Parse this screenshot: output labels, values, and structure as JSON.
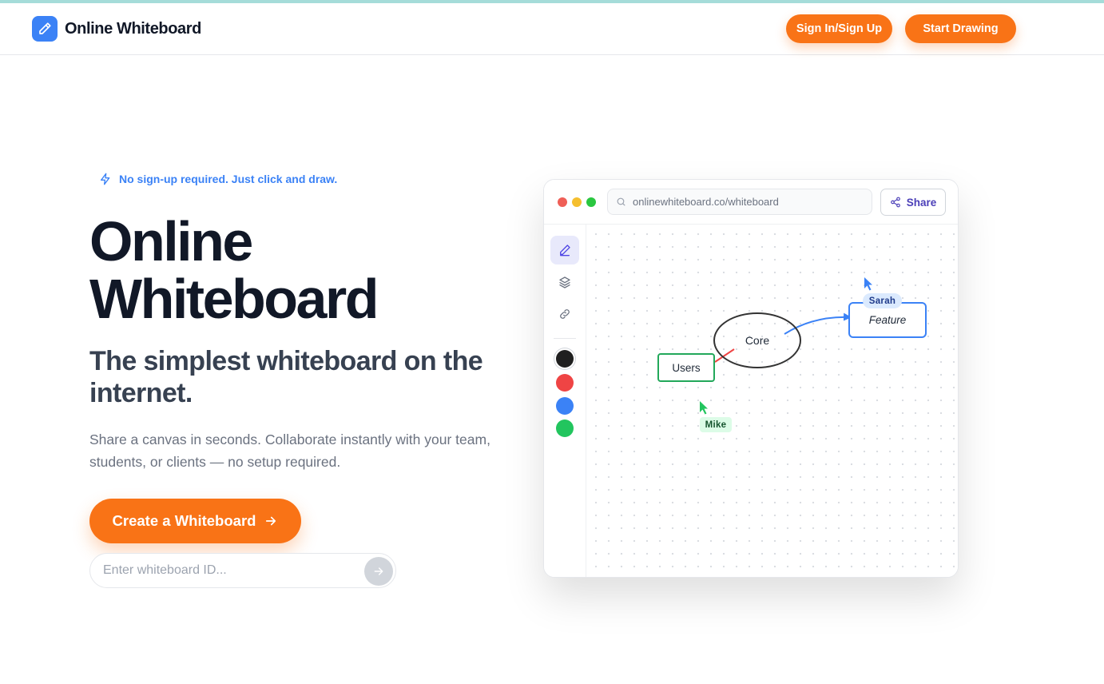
{
  "header": {
    "brand": "Online Whiteboard",
    "signin_label": "Sign In/Sign Up",
    "start_label": "Start Drawing"
  },
  "hero": {
    "badge": "No sign-up required. Just click and draw.",
    "title_line1": "Online",
    "title_line2": "Whiteboard",
    "subtitle": "The simplest whiteboard on the internet.",
    "description": "Share a canvas in seconds. Collaborate instantly with your team, students, or clients — no setup required.",
    "cta_label": "Create a Whiteboard",
    "id_placeholder": "Enter whiteboard ID..."
  },
  "mockup": {
    "url": "onlinewhiteboard.co/whiteboard",
    "share_label": "Share",
    "tools": [
      "pencil-icon",
      "layers-icon",
      "link-icon"
    ],
    "colors": [
      "#1f1f1f",
      "#ef4444",
      "#3b82f6",
      "#22c55e"
    ],
    "nodes": {
      "users": "Users",
      "core": "Core",
      "feature": "Feature"
    },
    "cursors": {
      "sarah": "Sarah",
      "mike": "Mike"
    }
  },
  "colors": {
    "accent": "#f97316",
    "brand_blue": "#3b82f6",
    "heading": "#111827"
  }
}
